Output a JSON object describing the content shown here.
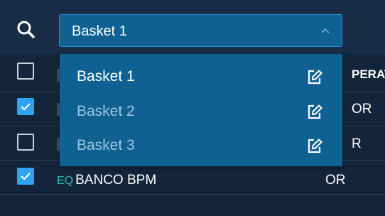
{
  "search": {
    "icon": "search-icon"
  },
  "basket_select": {
    "selected_value": "Basket 1",
    "icon": "chevron-up-icon",
    "options": [
      {
        "label": "Basket 1",
        "state": "selected",
        "edit_icon": "edit-icon"
      },
      {
        "label": "Basket 2",
        "state": "normal",
        "edit_icon": "edit-icon"
      },
      {
        "label": "Basket 3",
        "state": "normal",
        "edit_icon": "edit-icon"
      }
    ]
  },
  "table": {
    "header": {
      "operator_label": "PERAT"
    },
    "rows": [
      {
        "checked": true,
        "operator": "OR"
      },
      {
        "checked": false,
        "operator": "R"
      },
      {
        "checked": true,
        "type": "EQ",
        "name": "BANCO BPM",
        "operator": "OR"
      }
    ]
  },
  "colors": {
    "background": "#12253a",
    "topbar": "#182d45",
    "dropdown": "#0f6192",
    "accent": "#2ea3f2",
    "tag": "#2cc3b1"
  }
}
